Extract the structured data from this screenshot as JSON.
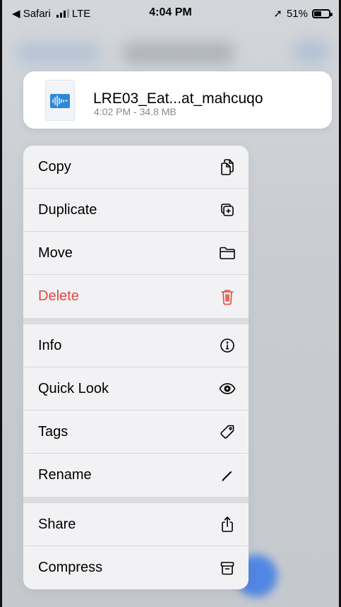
{
  "status_bar": {
    "back_app": "◀ Safari",
    "carrier": "LTE",
    "time": "4:04 PM",
    "location_arrow": "➚",
    "battery": "51%",
    "battery_level": 0.51
  },
  "file": {
    "name": "LRE03_Eat...at_mahcuqo",
    "meta": "4:02 PM - 34.8 MB"
  },
  "menu": {
    "groups": [
      [
        {
          "label": "Copy",
          "icon": "copy-icon"
        },
        {
          "label": "Duplicate",
          "icon": "duplicate-icon"
        },
        {
          "label": "Move",
          "icon": "folder-icon"
        },
        {
          "label": "Delete",
          "icon": "trash-icon",
          "color": "#e5463c"
        }
      ],
      [
        {
          "label": "Info",
          "icon": "info-icon"
        },
        {
          "label": "Quick Look",
          "icon": "eye-icon"
        },
        {
          "label": "Tags",
          "icon": "tag-icon"
        },
        {
          "label": "Rename",
          "icon": "pencil-icon"
        }
      ],
      [
        {
          "label": "Share",
          "icon": "share-icon"
        },
        {
          "label": "Compress",
          "icon": "archive-icon"
        }
      ]
    ]
  }
}
